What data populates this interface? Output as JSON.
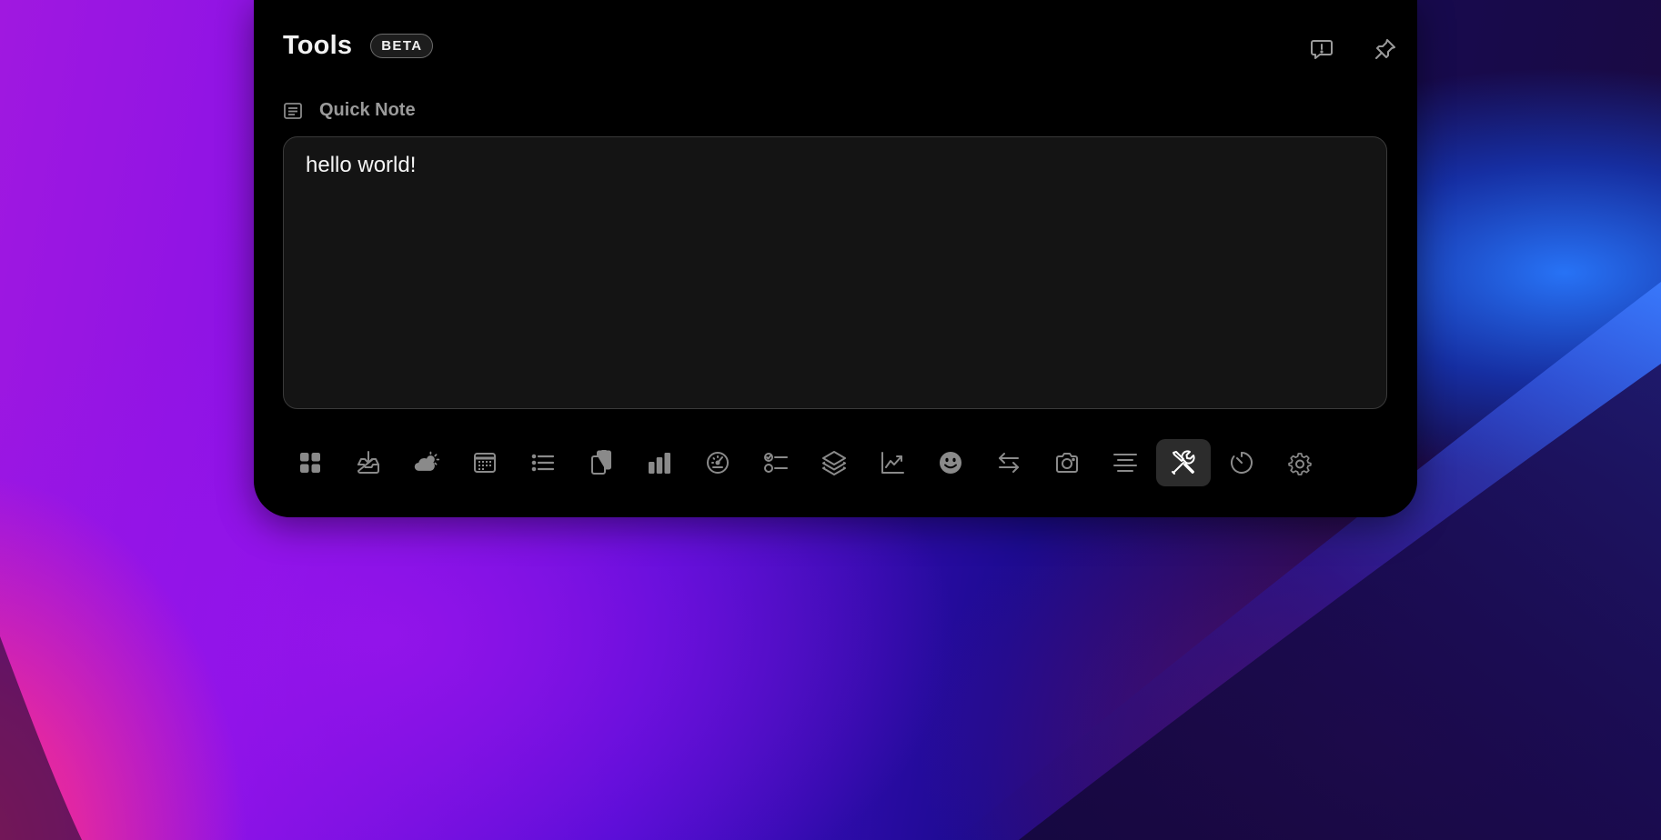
{
  "panel": {
    "title": "Tools",
    "badge": "BETA"
  },
  "header_actions": [
    {
      "icon": "feedback-icon",
      "action": "feedback"
    },
    {
      "icon": "pin-icon",
      "action": "pin"
    }
  ],
  "section": {
    "icon": "note-icon",
    "label": "Quick Note"
  },
  "note": {
    "value": "hello world!"
  },
  "toolbar": {
    "active_index": 15,
    "items": [
      {
        "icon": "widgets-grid-icon"
      },
      {
        "icon": "inbox-download-icon"
      },
      {
        "icon": "weather-icon"
      },
      {
        "icon": "calendar-icon"
      },
      {
        "icon": "list-icon"
      },
      {
        "icon": "clipboard-icon"
      },
      {
        "icon": "bar-chart-icon"
      },
      {
        "icon": "gauge-icon"
      },
      {
        "icon": "checklist-icon"
      },
      {
        "icon": "layers-icon"
      },
      {
        "icon": "line-chart-icon"
      },
      {
        "icon": "emoji-icon"
      },
      {
        "icon": "swap-arrows-icon"
      },
      {
        "icon": "camera-icon"
      },
      {
        "icon": "align-center-icon"
      },
      {
        "icon": "tools-icon"
      },
      {
        "icon": "timer-icon"
      },
      {
        "icon": "settings-gear-icon"
      }
    ]
  },
  "colors": {
    "panel_bg": "#000000",
    "note_bg": "#141414",
    "icon": "#8a8a8a",
    "icon_active": "#ffffff",
    "active_bg": "#2c2c2c"
  }
}
